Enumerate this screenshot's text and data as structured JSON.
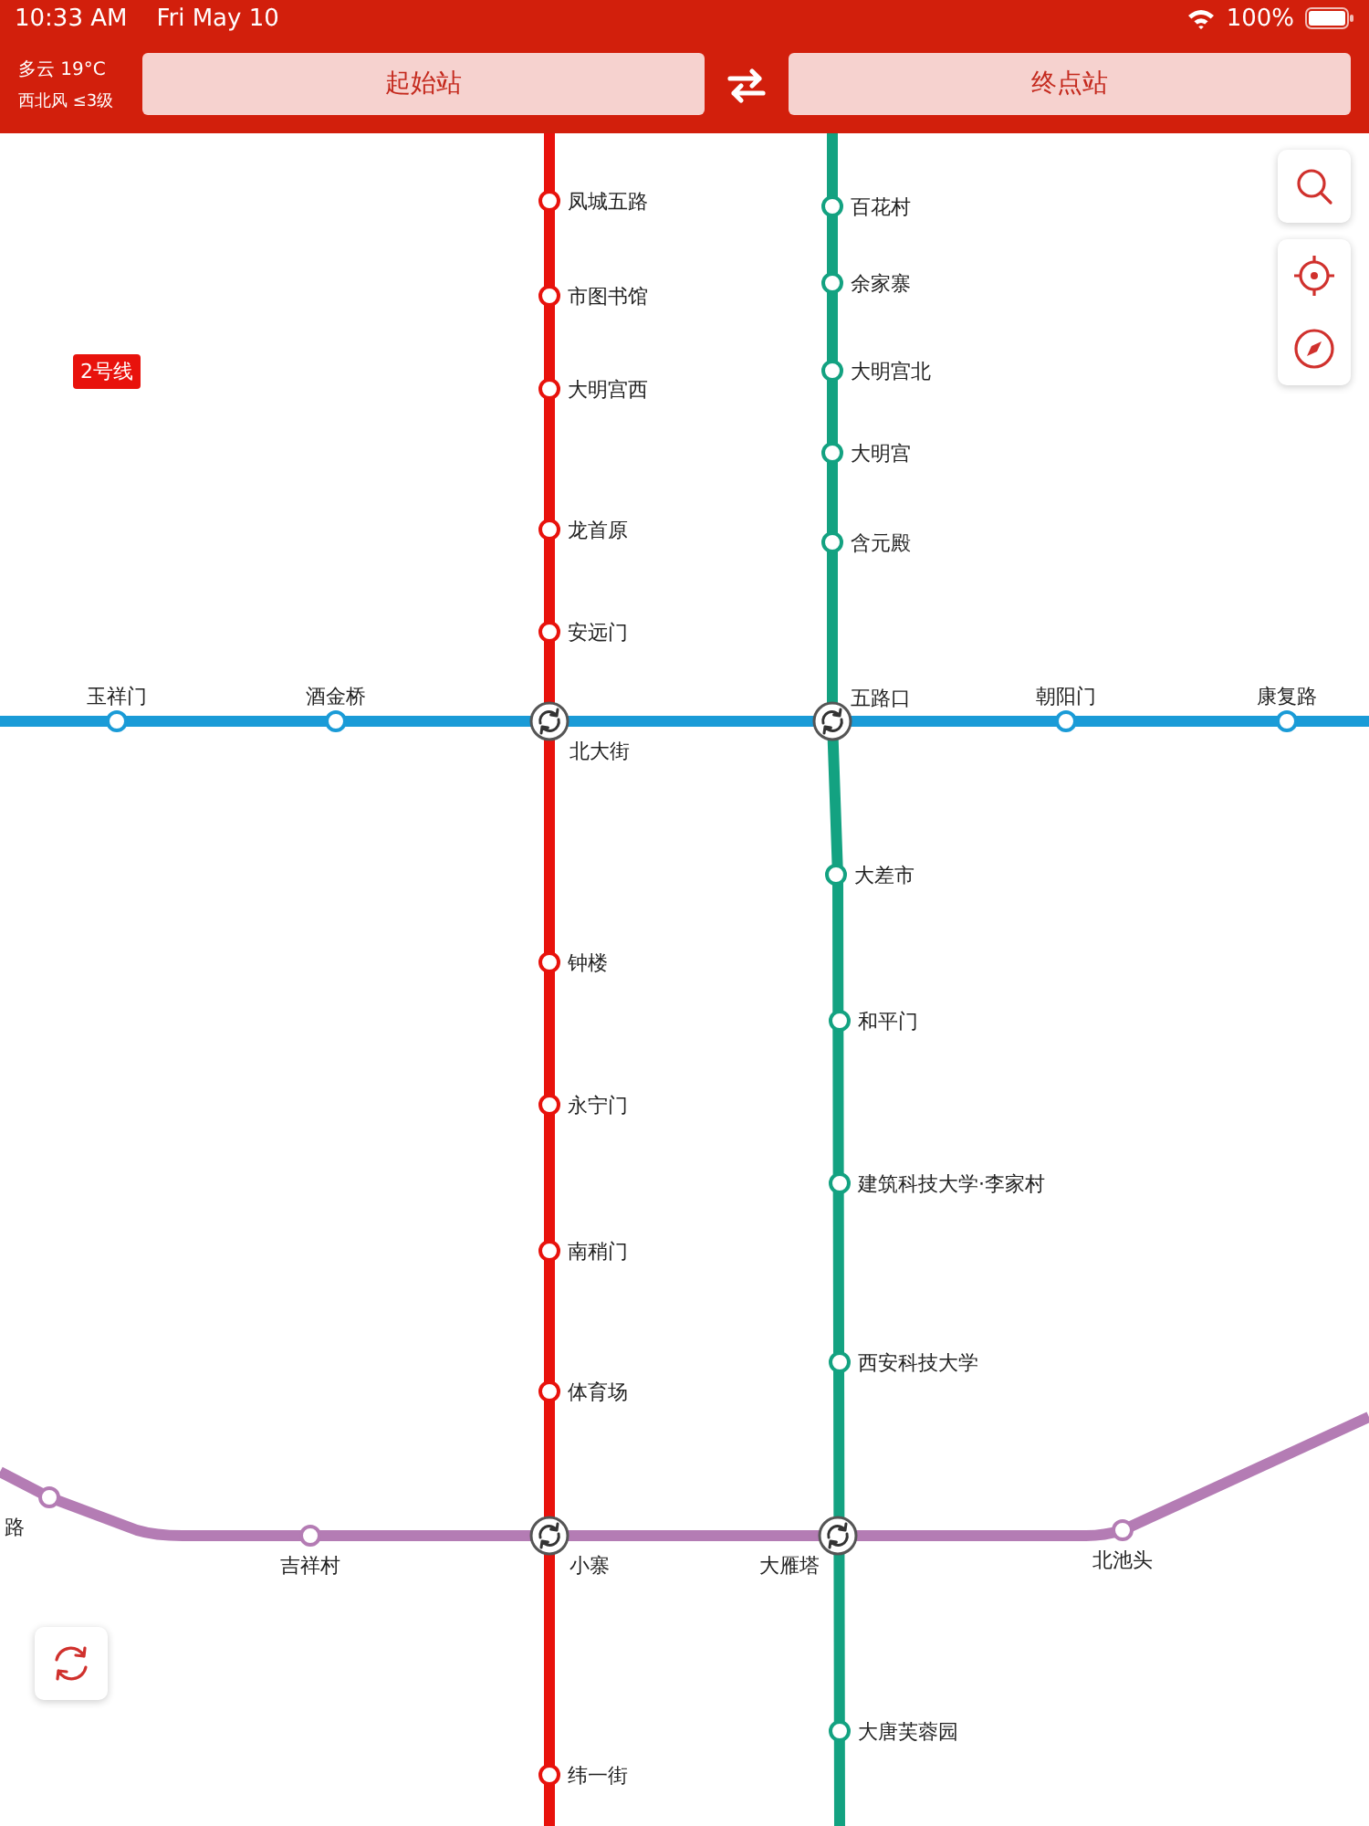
{
  "status_bar": {
    "time": "10:33 AM",
    "date": "Fri May 10",
    "battery": "100%"
  },
  "header": {
    "weather": "多云 19°C",
    "wind": "西北风 ≤3级",
    "origin": {
      "label": "起始站"
    },
    "destination": {
      "label": "终点站"
    }
  },
  "map": {
    "line_tag": {
      "label": "2号线",
      "color": "#e8120c"
    },
    "lines": [
      {
        "color": "#e8120c",
        "stations": [
          {
            "name": "凤城五路"
          },
          {
            "name": "市图书馆"
          },
          {
            "name": "大明宫西"
          },
          {
            "name": "龙首原"
          },
          {
            "name": "安远门"
          },
          {
            "name": "钟楼"
          },
          {
            "name": "永宁门"
          },
          {
            "name": "南稍门"
          },
          {
            "name": "体育场"
          },
          {
            "name": "纬一街"
          }
        ]
      },
      {
        "color": "#13a281",
        "stations": [
          {
            "name": "百花村"
          },
          {
            "name": "余家寨"
          },
          {
            "name": "大明宫北"
          },
          {
            "name": "大明宫"
          },
          {
            "name": "含元殿"
          },
          {
            "name": "大差市"
          },
          {
            "name": "和平门"
          },
          {
            "name": "建筑科技大学·李家村"
          },
          {
            "name": "西安科技大学"
          },
          {
            "name": "大唐芙蓉园"
          }
        ]
      },
      {
        "color": "#1a9bd7",
        "stations": [
          {
            "name": "玉祥门"
          },
          {
            "name": "酒金桥"
          },
          {
            "name": "朝阳门"
          },
          {
            "name": "康复路"
          }
        ]
      },
      {
        "color": "#b47cb4",
        "stations": [
          {
            "name": "路"
          },
          {
            "name": "吉祥村"
          },
          {
            "name": "北池头"
          }
        ]
      }
    ],
    "interchanges": [
      {
        "name": "北大街"
      },
      {
        "name": "五路口"
      },
      {
        "name": "小寨"
      },
      {
        "name": "大雁塔"
      }
    ]
  }
}
